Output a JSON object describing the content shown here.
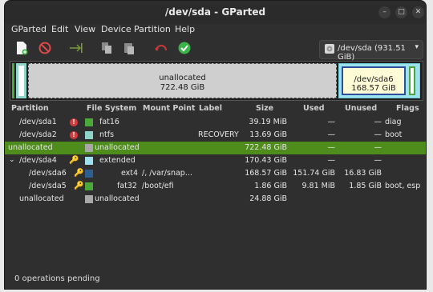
{
  "window": {
    "title": "/dev/sda - GParted"
  },
  "menu": [
    "GParted",
    "Edit",
    "View",
    "Device",
    "Partition",
    "Help"
  ],
  "device_selector": {
    "label": "/dev/sda (931.51 GiB)"
  },
  "disk_map": {
    "unallocated": {
      "name": "unallocated",
      "size": "722.48 GiB"
    },
    "selected": {
      "name": "/dev/sda6",
      "size": "168.57 GiB"
    }
  },
  "columns": [
    "Partition",
    "File System",
    "Mount Point",
    "Label",
    "Size",
    "Used",
    "Unused",
    "Flags"
  ],
  "rows": [
    {
      "partition": "/dev/sda1",
      "warn": true,
      "key": false,
      "fs_color": "#4aa93a",
      "fs": "fat16",
      "mount": "",
      "label": "",
      "size": "39.19 MiB",
      "used": "—",
      "unused": "—",
      "flags": "diag"
    },
    {
      "partition": "/dev/sda2",
      "warn": true,
      "key": false,
      "fs_color": "#8fd4c8",
      "fs": "ntfs",
      "mount": "",
      "label": "RECOVERY",
      "size": "13.69 GiB",
      "used": "—",
      "unused": "—",
      "flags": "boot"
    },
    {
      "partition": "unallocated",
      "warn": false,
      "key": false,
      "fs_color": "#a8a8a8",
      "fs": "unallocated",
      "mount": "",
      "label": "",
      "size": "722.48 GiB",
      "used": "—",
      "unused": "—",
      "flags": ""
    },
    {
      "partition": "/dev/sda4",
      "warn": false,
      "key": true,
      "fs_color": "#9ee1ee",
      "fs": "extended",
      "mount": "",
      "label": "",
      "size": "170.43 GiB",
      "used": "—",
      "unused": "—",
      "flags": ""
    },
    {
      "partition": "/dev/sda6",
      "warn": false,
      "key": true,
      "fs_color": "#2f5f8f",
      "fs": "ext4",
      "mount": "/, /var/snap...",
      "label": "",
      "size": "168.57 GiB",
      "used": "151.74 GiB",
      "unused": "16.83 GiB",
      "flags": ""
    },
    {
      "partition": "/dev/sda5",
      "warn": false,
      "key": true,
      "fs_color": "#4aa93a",
      "fs": "fat32",
      "mount": "/boot/efi",
      "label": "",
      "size": "1.86 GiB",
      "used": "9.81 MiB",
      "unused": "1.85 GiB",
      "flags": "boot, esp"
    },
    {
      "partition": "unallocated",
      "warn": false,
      "key": false,
      "fs_color": "#a8a8a8",
      "fs": "unallocated",
      "mount": "",
      "label": "",
      "size": "24.88 GiB",
      "used": "—",
      "unused": "—",
      "flags": ""
    }
  ],
  "status": "0 operations pending"
}
